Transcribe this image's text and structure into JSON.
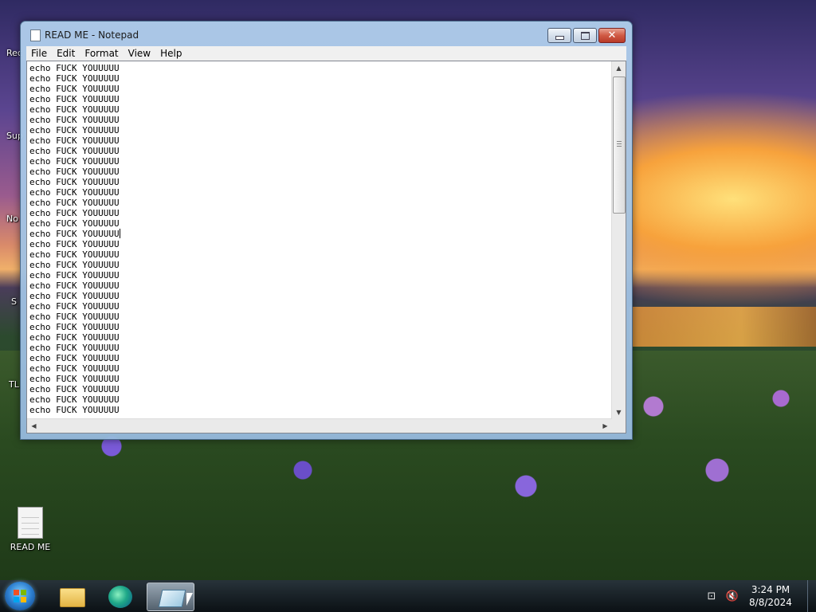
{
  "desktop": {
    "icons": [
      {
        "label": "READ ME"
      }
    ],
    "partial_labels": [
      "Rec",
      "Sup",
      "No",
      "S",
      "TL"
    ]
  },
  "window": {
    "title": "READ ME - Notepad",
    "menu": [
      "File",
      "Edit",
      "Format",
      "View",
      "Help"
    ],
    "lines": [
      "echo FUCK YOUUUUU",
      "echo FUCK YOUUUUU",
      "echo FUCK YOUUUUU",
      "echo FUCK YOUUUUU",
      "echo FUCK YOUUUUU",
      "echo FUCK YOUUUUU",
      "echo FUCK YOUUUUU",
      "echo FUCK YOUUUUU",
      "echo FUCK YOUUUUU",
      "echo FUCK YOUUUUU",
      "echo FUCK YOUUUUU",
      "echo FUCK YOUUUUU",
      "echo FUCK YOUUUUU",
      "echo FUCK YOUUUUU",
      "echo FUCK YOUUUUU",
      "echo FUCK YOUUUUU",
      "echo FUCK YOUUUUU",
      "echo FUCK YOUUUUU",
      "echo FUCK YOUUUUU",
      "echo FUCK YOUUUUU",
      "echo FUCK YOUUUUU",
      "echo FUCK YOUUUUU",
      "echo FUCK YOUUUUU",
      "echo FUCK YOUUUUU",
      "echo FUCK YOUUUUU",
      "echo FUCK YOUUUUU",
      "echo FUCK YOUUUUU",
      "echo FUCK YOUUUUU",
      "echo FUCK YOUUUUU",
      "echo FUCK YOUUUUU",
      "echo FUCK YOUUUUU",
      "echo FUCK YOUUUUU",
      "echo FUCK YOUUUUU",
      "echo FUCK YOUUUUU"
    ],
    "caret_line": 16,
    "caption_buttons": {
      "minimize": "minimize-icon",
      "maximize": "maximize-icon",
      "close": "close-icon"
    }
  },
  "taskbar": {
    "apps": [
      {
        "name": "file-explorer",
        "icon": "folder-icon"
      },
      {
        "name": "edge",
        "icon": "edge-icon"
      },
      {
        "name": "notepad",
        "icon": "notepad-icon",
        "active": true
      }
    ],
    "clock": {
      "time": "3:24 PM",
      "date": "8/8/2024"
    },
    "tray_icons": [
      "network-icon",
      "volume-muted-icon"
    ]
  }
}
